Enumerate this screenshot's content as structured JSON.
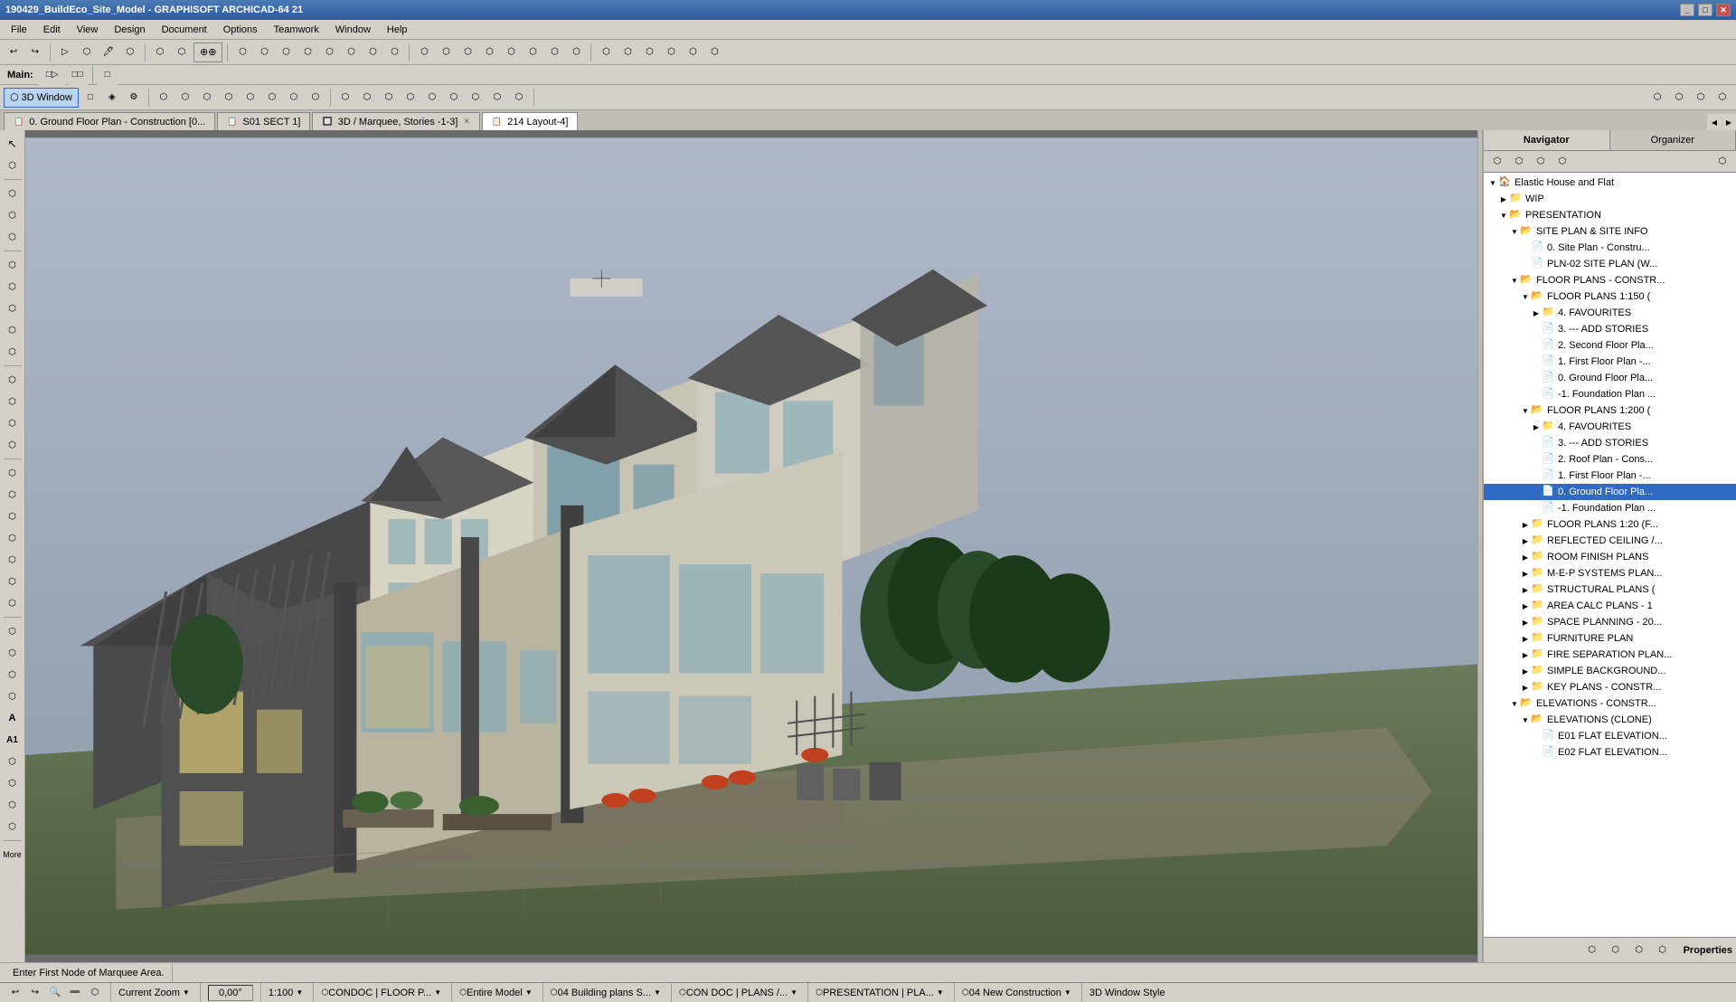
{
  "titlebar": {
    "title": "190429_BuildEco_Site_Model - GRAPHISOFT ARCHICAD-64 21",
    "controls": [
      "_",
      "□",
      "✕"
    ]
  },
  "menubar": {
    "items": [
      "File",
      "Edit",
      "View",
      "Design",
      "Document",
      "Options",
      "Teamwork",
      "Window",
      "Help"
    ]
  },
  "toolbar1": {
    "buttons": [
      "↩",
      "↪",
      "✦",
      "▷",
      "⬡",
      "⬡",
      "⬡",
      "⬡",
      "⊕",
      "⊕",
      "⊕",
      "⊕",
      "⊕",
      "⊕",
      "⊕",
      "⊕",
      "⊕",
      "⊕"
    ]
  },
  "secondary_toolbar": {
    "label": "Main:",
    "buttons": [
      "□▷",
      "□□"
    ]
  },
  "mode_toolbar": {
    "active_btn": "3D Window",
    "buttons": [
      "3D Window",
      "□",
      "◈",
      "⚙"
    ]
  },
  "tabs": [
    {
      "id": "t1",
      "label": "0. Ground Floor Plan - Construction [0...",
      "active": false,
      "closeable": false,
      "icon": "📋"
    },
    {
      "id": "t2",
      "label": "S01 SECT 1]",
      "active": false,
      "closeable": false,
      "icon": "📋"
    },
    {
      "id": "t3",
      "label": "3D / Marquee, Stories -1-3]",
      "active": false,
      "closeable": true,
      "icon": "🔲"
    },
    {
      "id": "t4",
      "label": "214 Layout-4]",
      "active": true,
      "closeable": false,
      "icon": "📋"
    }
  ],
  "left_toolbar": {
    "groups": [
      {
        "tools": [
          "↖",
          "⬡",
          "⬡"
        ]
      },
      {
        "tools": [
          "⬡",
          "⬡",
          "⬡",
          "⬡"
        ]
      },
      {
        "tools": [
          "⬡",
          "⬡",
          "⬡",
          "⬡",
          "⬡"
        ]
      },
      {
        "tools": [
          "⬡",
          "⬡",
          "⬡",
          "⬡"
        ]
      },
      {
        "tools": [
          "⬡",
          "⬡",
          "⬡",
          "⬡",
          "⬡",
          "⬡",
          "⬡"
        ]
      },
      {
        "tools": [
          "⬡",
          "⬡",
          "⬡",
          "⬡",
          "A",
          "A1",
          "⬡",
          "⬡",
          "⬡",
          "⊕"
        ]
      }
    ]
  },
  "tree": {
    "items": [
      {
        "id": "elastic",
        "label": "Elastic House and Flat",
        "level": 0,
        "type": "project",
        "expanded": true,
        "arrow": "down"
      },
      {
        "id": "wip",
        "label": "WIP",
        "level": 1,
        "type": "folder",
        "expanded": false,
        "arrow": "right"
      },
      {
        "id": "presentation",
        "label": "PRESENTATION",
        "level": 1,
        "type": "folder",
        "expanded": true,
        "arrow": "down"
      },
      {
        "id": "site_plan",
        "label": "SITE PLAN & SITE INFO",
        "level": 2,
        "type": "folder",
        "expanded": true,
        "arrow": "down"
      },
      {
        "id": "site_plan_con",
        "label": "0. Site Plan - Constru...",
        "level": 3,
        "type": "doc",
        "arrow": "none"
      },
      {
        "id": "pln02",
        "label": "PLN-02 SITE PLAN (W...",
        "level": 3,
        "type": "doc",
        "arrow": "none"
      },
      {
        "id": "floor_plans_con",
        "label": "FLOOR PLANS - CONSTR...",
        "level": 2,
        "type": "folder",
        "expanded": true,
        "arrow": "down"
      },
      {
        "id": "fp_1150",
        "label": "FLOOR PLANS 1:150 (",
        "level": 3,
        "type": "folder",
        "expanded": true,
        "arrow": "down"
      },
      {
        "id": "fp_fav",
        "label": "4. FAVOURITES",
        "level": 4,
        "type": "folder",
        "expanded": false,
        "arrow": "right"
      },
      {
        "id": "fp_add",
        "label": "3. --- ADD STORIES",
        "level": 4,
        "type": "doc",
        "arrow": "none"
      },
      {
        "id": "fp_2nd",
        "label": "2. Second Floor Pla...",
        "level": 4,
        "type": "doc",
        "arrow": "none"
      },
      {
        "id": "fp_1st",
        "label": "1. First Floor Plan -...",
        "level": 4,
        "type": "doc",
        "arrow": "none"
      },
      {
        "id": "fp_gnd",
        "label": "0. Ground Floor Pla...",
        "level": 4,
        "type": "doc",
        "arrow": "none"
      },
      {
        "id": "fp_foundation",
        "label": "-1. Foundation Plan ...",
        "level": 4,
        "type": "doc",
        "arrow": "none"
      },
      {
        "id": "fp_1200",
        "label": "FLOOR PLANS 1:200 (",
        "level": 3,
        "type": "folder",
        "expanded": true,
        "arrow": "down"
      },
      {
        "id": "fp_fav2",
        "label": "4. FAVOURITES",
        "level": 4,
        "type": "folder",
        "expanded": false,
        "arrow": "right"
      },
      {
        "id": "fp_add2",
        "label": "3. --- ADD STORIES",
        "level": 4,
        "type": "doc",
        "arrow": "none"
      },
      {
        "id": "fp_roof",
        "label": "2. Roof Plan - Cons...",
        "level": 4,
        "type": "doc",
        "arrow": "none"
      },
      {
        "id": "fp_1st2",
        "label": "1. First Floor Plan -...",
        "level": 4,
        "type": "doc",
        "arrow": "none"
      },
      {
        "id": "fp_gnd2",
        "label": "0. Ground Floor Pla...",
        "level": 4,
        "type": "doc",
        "arrow": "none",
        "selected": true
      },
      {
        "id": "fp_fnd2",
        "label": "-1. Foundation Plan ...",
        "level": 4,
        "type": "doc",
        "arrow": "none"
      },
      {
        "id": "fp_1220",
        "label": "FLOOR PLANS 1:20 (F...",
        "level": 3,
        "type": "folder",
        "expanded": false,
        "arrow": "right"
      },
      {
        "id": "reflected",
        "label": "REFLECTED CEILING /...",
        "level": 3,
        "type": "folder",
        "expanded": false,
        "arrow": "right"
      },
      {
        "id": "room_finish",
        "label": "ROOM FINISH PLANS",
        "level": 3,
        "type": "folder",
        "expanded": false,
        "arrow": "right"
      },
      {
        "id": "mep",
        "label": "M-E-P SYSTEMS PLAN...",
        "level": 3,
        "type": "folder",
        "expanded": false,
        "arrow": "right"
      },
      {
        "id": "structural",
        "label": "STRUCTURAL PLANS (",
        "level": 3,
        "type": "folder",
        "expanded": false,
        "arrow": "right"
      },
      {
        "id": "area",
        "label": "AREA CALC PLANS - 1",
        "level": 3,
        "type": "folder",
        "expanded": false,
        "arrow": "right"
      },
      {
        "id": "space",
        "label": "SPACE PLANNING - 20...",
        "level": 3,
        "type": "folder",
        "expanded": false,
        "arrow": "right"
      },
      {
        "id": "furniture",
        "label": "FURNITURE PLAN",
        "level": 3,
        "type": "folder",
        "expanded": false,
        "arrow": "right"
      },
      {
        "id": "fire",
        "label": "FIRE SEPARATION PLAN...",
        "level": 3,
        "type": "folder",
        "expanded": false,
        "arrow": "right"
      },
      {
        "id": "simple",
        "label": "SIMPLE BACKGROUND...",
        "level": 3,
        "type": "folder",
        "expanded": false,
        "arrow": "right"
      },
      {
        "id": "key",
        "label": "KEY PLANS - CONSTR...",
        "level": 3,
        "type": "folder",
        "expanded": false,
        "arrow": "right"
      },
      {
        "id": "elevations",
        "label": "ELEVATIONS - CONSTR...",
        "level": 2,
        "type": "folder",
        "expanded": true,
        "arrow": "down"
      },
      {
        "id": "elev_clone",
        "label": "ELEVATIONS (CLONE)",
        "level": 3,
        "type": "folder",
        "expanded": true,
        "arrow": "down"
      },
      {
        "id": "e01",
        "label": "E01 FLAT ELEVATION...",
        "level": 4,
        "type": "doc",
        "arrow": "none"
      },
      {
        "id": "e02",
        "label": "E02 FLAT ELEVATION...",
        "level": 4,
        "type": "doc",
        "arrow": "none"
      }
    ]
  },
  "statusbar": {
    "info_label": "Enter First Node of Marquee Area.",
    "zoom_label": "Current Zoom",
    "zoom_value": "0,00°",
    "scale": "1:100",
    "condoc": "CONDOC | FLOOR P...",
    "model": "Entire Model",
    "building_plans": "04 Building plans S...",
    "con_doc": "CON DOC | PLANS /...",
    "presentation": "PRESENTATION | PLA...",
    "new_construction": "04 New Construction",
    "window_style": "3D Window Style",
    "properties": "Properties"
  },
  "colors": {
    "accent": "#316ac5",
    "toolbar_bg": "#d4d0c8",
    "tree_selected": "#316ac5",
    "tab_active": "#ffffff"
  }
}
